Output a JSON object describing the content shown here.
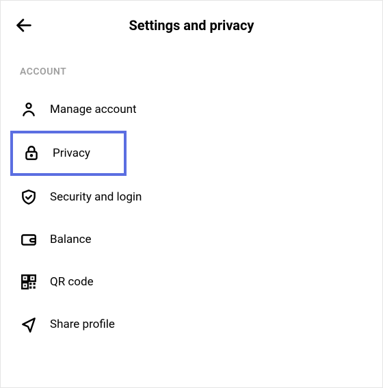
{
  "header": {
    "title": "Settings and privacy"
  },
  "section": {
    "label": "ACCOUNT"
  },
  "items": [
    {
      "label": "Manage account"
    },
    {
      "label": "Privacy"
    },
    {
      "label": "Security and login"
    },
    {
      "label": "Balance"
    },
    {
      "label": "QR code"
    },
    {
      "label": "Share profile"
    }
  ]
}
